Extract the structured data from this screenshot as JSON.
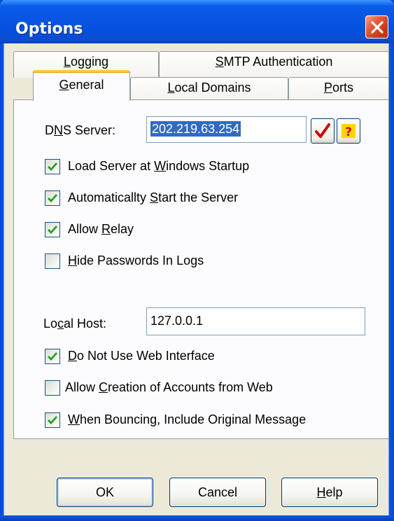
{
  "window": {
    "title": "Options"
  },
  "tabs": {
    "row1": [
      {
        "label_pre": "",
        "label_key": "L",
        "label_post": "ogging"
      },
      {
        "label_pre": "",
        "label_key": "S",
        "label_post": "MTP Authentication"
      }
    ],
    "row2": [
      {
        "label_pre": "",
        "label_key": "G",
        "label_post": "eneral",
        "active": true
      },
      {
        "label_pre": "",
        "label_key": "L",
        "label_post": "ocal Domains"
      },
      {
        "label_pre": "",
        "label_key": "P",
        "label_post": "orts"
      }
    ]
  },
  "general": {
    "dns_label_pre": "D",
    "dns_label_key": "N",
    "dns_label_post": "S Server:",
    "dns_value": "202.219.63.254",
    "checks": [
      {
        "pre": "Load Server at ",
        "key": "W",
        "post": "indows Startup",
        "checked": true
      },
      {
        "pre": "Automaticallty ",
        "key": "S",
        "post": "tart the Server",
        "checked": true
      },
      {
        "pre": "Allow ",
        "key": "R",
        "post": "elay",
        "checked": true
      },
      {
        "pre": "",
        "key": "H",
        "post": "ide Passwords In Logs",
        "checked": false
      }
    ],
    "localhost_label_pre": "Lo",
    "localhost_label_key": "c",
    "localhost_label_post": "al Host:",
    "localhost_value": "127.0.0.1",
    "checks2": [
      {
        "pre": "",
        "key": "D",
        "post": "o Not Use Web Interface",
        "checked": true
      },
      {
        "pre": "Allow ",
        "key": "C",
        "post": "reation of Accounts from Web",
        "checked": false
      },
      {
        "pre": "",
        "key": "W",
        "post": "hen Bouncing, Include Original Message",
        "checked": true
      }
    ]
  },
  "buttons": {
    "ok": "OK",
    "cancel": "Cancel",
    "help_key": "H",
    "help_post": "elp"
  },
  "icons": {
    "close": "close-icon",
    "check_dns": "checkmark-icon",
    "help_dns": "question-icon"
  },
  "colors": {
    "title_bar": "#0755e2",
    "close_button": "#cf3a14",
    "tab_highlight": "#ffc83c",
    "checkmark": "#21a121",
    "selection": "#316ac5",
    "dialog_bg": "#ece9d8"
  }
}
